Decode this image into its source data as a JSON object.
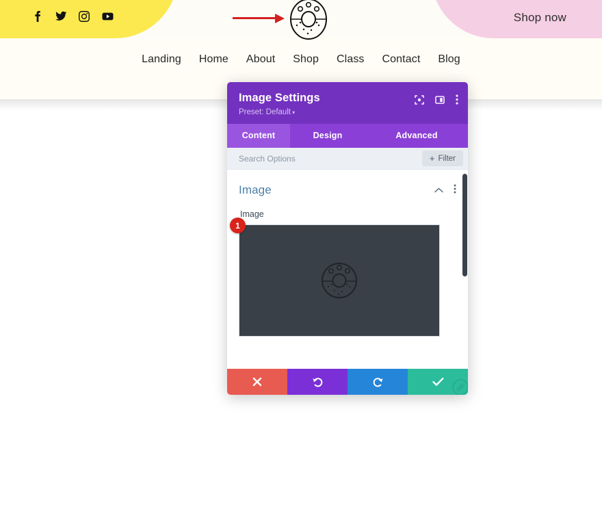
{
  "site": {
    "social": [
      {
        "name": "facebook-icon",
        "label": "Facebook"
      },
      {
        "name": "twitter-icon",
        "label": "Twitter"
      },
      {
        "name": "instagram-icon",
        "label": "Instagram"
      },
      {
        "name": "youtube-icon",
        "label": "YouTube"
      }
    ],
    "cta_label": "Shop now",
    "logo_alt": "Donut logo",
    "nav": [
      "Landing",
      "Home",
      "About",
      "Shop",
      "Class",
      "Contact",
      "Blog"
    ],
    "colors": {
      "yellow": "#fbe94f",
      "pink": "#f5cfe4",
      "arrow_red": "#d32020",
      "page_bg": "#fffdf6"
    }
  },
  "modal": {
    "title": "Image Settings",
    "preset_label": "Preset: Default",
    "preset_caret": "▾",
    "header_icons": [
      {
        "name": "focus-icon"
      },
      {
        "name": "panel-layout-icon"
      },
      {
        "name": "more-vertical-icon"
      }
    ],
    "tabs": [
      {
        "label": "Content",
        "active": true
      },
      {
        "label": "Design",
        "active": false
      },
      {
        "label": "Advanced",
        "active": false
      }
    ],
    "search": {
      "placeholder": "Search Options",
      "value": ""
    },
    "filter_button": {
      "plus": "+",
      "label": "Filter"
    },
    "section": {
      "title": "Image",
      "collapse_icon": "chevron-up-icon",
      "menu_icon": "more-vertical-icon"
    },
    "field": {
      "label": "Image",
      "badge": "1",
      "preview_bg": "#3a4048"
    },
    "actions": [
      {
        "name": "cancel-button",
        "icon": "close-icon",
        "color": "#e85b51"
      },
      {
        "name": "undo-button",
        "icon": "undo-icon",
        "color": "#7b2fd6"
      },
      {
        "name": "redo-button",
        "icon": "redo-icon",
        "color": "#2585d8"
      },
      {
        "name": "save-button",
        "icon": "check-icon",
        "color": "#2bbd9b"
      }
    ],
    "colors": {
      "header": "#7331c0",
      "tabbar": "#8a3fd6",
      "tab_active": "#9a55e0",
      "section_title": "#4a7fa8",
      "badge_red": "#d8221c"
    }
  }
}
